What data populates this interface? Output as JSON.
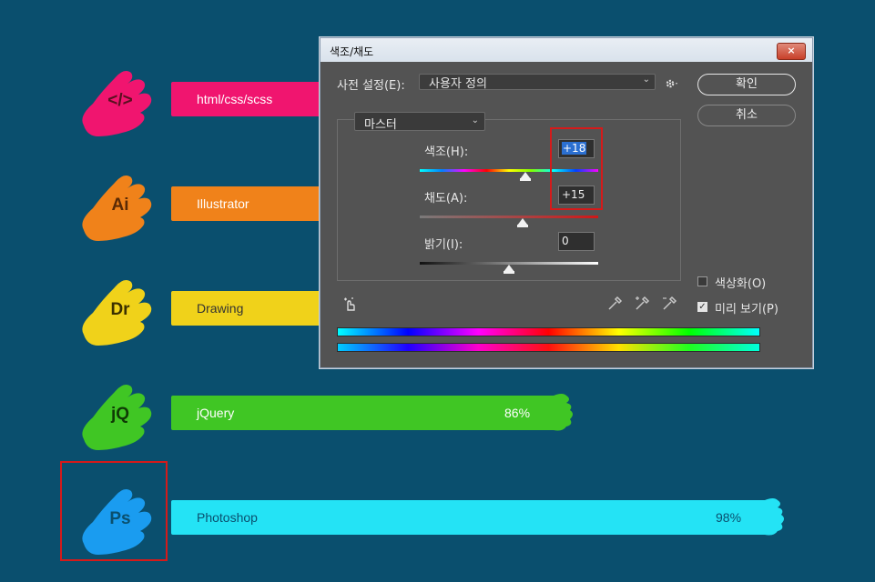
{
  "skills": [
    {
      "badge": "</>",
      "name": "html/css/scss",
      "color": "#f0156f",
      "badge_color": "#f0156f",
      "text_color": "#ffffff",
      "percent": "",
      "level": null
    },
    {
      "badge": "Ai",
      "name": "Illustrator",
      "color": "#f0821a",
      "badge_color": "#f0821a",
      "text_color": "#ffffff",
      "percent": "",
      "level": null
    },
    {
      "badge": "Dr",
      "name": "Drawing",
      "color": "#f0d21a",
      "badge_color": "#f0d21a",
      "text_color": "#333333",
      "percent": "",
      "level": null
    },
    {
      "badge": "jQ",
      "name": "jQuery",
      "color": "#40c624",
      "badge_color": "#40c624",
      "text_color": "#ffffff",
      "percent": "86%",
      "level": 0.86
    },
    {
      "badge": "Ps",
      "name": "Photoshop",
      "color": "#24e3f5",
      "badge_color": "#1a9cf0",
      "text_color": "#0a4f6e",
      "percent": "98%",
      "level": 0.98
    }
  ],
  "dialog": {
    "title": "색조/채도",
    "close_label": "×",
    "preset_label": "사전 설정(E):",
    "preset_value": "사용자 정의",
    "ok_label": "확인",
    "cancel_label": "취소",
    "channel_value": "마스터",
    "hue_label": "색조(H):",
    "hue_value": "+18",
    "saturation_label": "채도(A):",
    "saturation_value": "+15",
    "lightness_label": "밝기(I):",
    "lightness_value": "0",
    "colorize_label": "색상화(O)",
    "colorize_checked": false,
    "preview_label": "미리 보기(P)",
    "preview_checked": true,
    "accent_border": "#d51a1a"
  },
  "icons": {
    "settings": "gear-icon",
    "hand_tool": "on-image-adjust-icon",
    "eyedropper": "eyedropper-icon",
    "eyedropper_plus": "eyedropper-add-icon",
    "eyedropper_minus": "eyedropper-subtract-icon"
  }
}
